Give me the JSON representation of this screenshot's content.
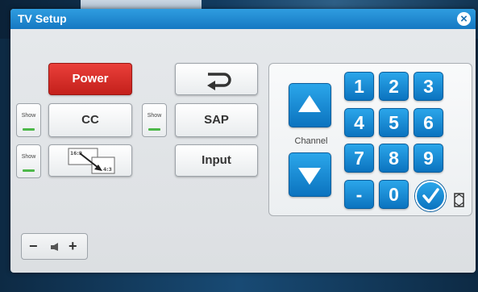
{
  "window": {
    "title": "TV Setup"
  },
  "buttons": {
    "power": "Power",
    "cc": "CC",
    "sap": "SAP",
    "input": "Input",
    "show_1": "Show",
    "show_2": "Show",
    "show_3": "Show"
  },
  "aspect": {
    "from": "16:9",
    "to": "4:3"
  },
  "keypad": {
    "channel_label": "Channel",
    "digits": [
      "1",
      "2",
      "3",
      "4",
      "5",
      "6",
      "7",
      "8",
      "9",
      "-",
      "0"
    ]
  },
  "volume": {
    "minus": "−",
    "plus": "+"
  },
  "colors": {
    "power": "#d42a25",
    "accent": "#1a8ad6",
    "show_led": "#4db84a"
  }
}
